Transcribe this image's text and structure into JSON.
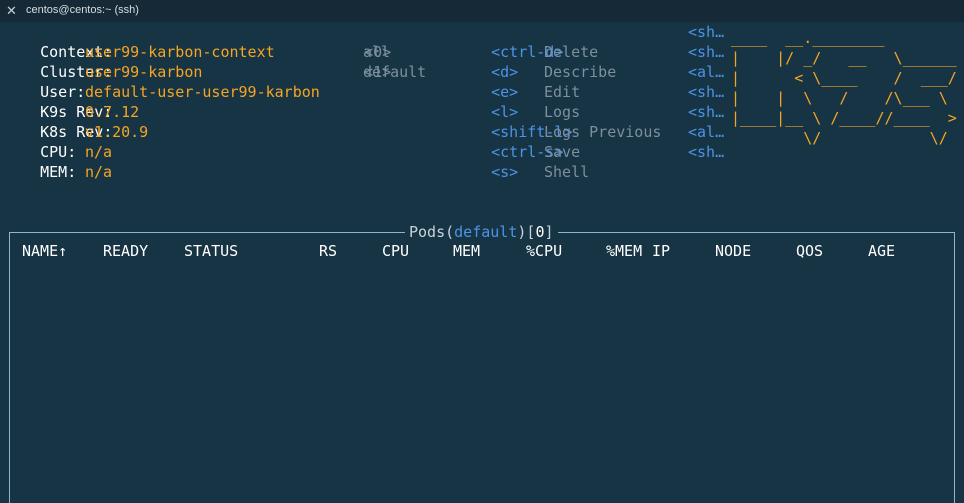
{
  "window": {
    "title": "centos@centos:~ (ssh)"
  },
  "info": [
    {
      "label": "Context:",
      "value": "user99-karbon-context"
    },
    {
      "label": "Cluster:",
      "value": "user99-karbon"
    },
    {
      "label": "User:",
      "value": "default-user-user99-karbon"
    },
    {
      "label": "K9s Rev:",
      "value": "0.7.12"
    },
    {
      "label": "K8s Rev:",
      "value": "v1.20.9"
    },
    {
      "label": "CPU:",
      "value": "n/a"
    },
    {
      "label": "MEM:",
      "value": "n/a"
    }
  ],
  "namespaces": [
    {
      "key": "<0>",
      "name": "all"
    },
    {
      "key": "<1>",
      "name": "default"
    }
  ],
  "shortcuts": [
    {
      "key": "<ctrl-d>",
      "action": "Delete"
    },
    {
      "key": "<d>",
      "action": "Describe"
    },
    {
      "key": "<e>",
      "action": "Edit"
    },
    {
      "key": "<l>",
      "action": "Logs"
    },
    {
      "key": "<shift-l>",
      "action": "Logs Previous"
    },
    {
      "key": "<ctrl-s>",
      "action": "Save"
    },
    {
      "key": "<s>",
      "action": "Shell"
    }
  ],
  "more_shortcuts": [
    "<sh…",
    "<sh…",
    "<al…",
    "<sh…",
    "<sh…",
    "<al…",
    "<sh…"
  ],
  "logo": {
    "lines": [
      "____  __.________",
      "|    |/ _/   __   \\______",
      "|      < \\____    /  ___/",
      "|    |  \\   /    /\\___ \\",
      "|____|__ \\ /____//____  >",
      "        \\/            \\/"
    ]
  },
  "table": {
    "resource": "Pods",
    "namespace": "default",
    "count": "0",
    "columns": [
      "NAME↑",
      "READY",
      "STATUS",
      "RS",
      "CPU",
      "MEM",
      "%CPU",
      "%MEM",
      "IP",
      "NODE",
      "QOS",
      "AGE"
    ]
  }
}
